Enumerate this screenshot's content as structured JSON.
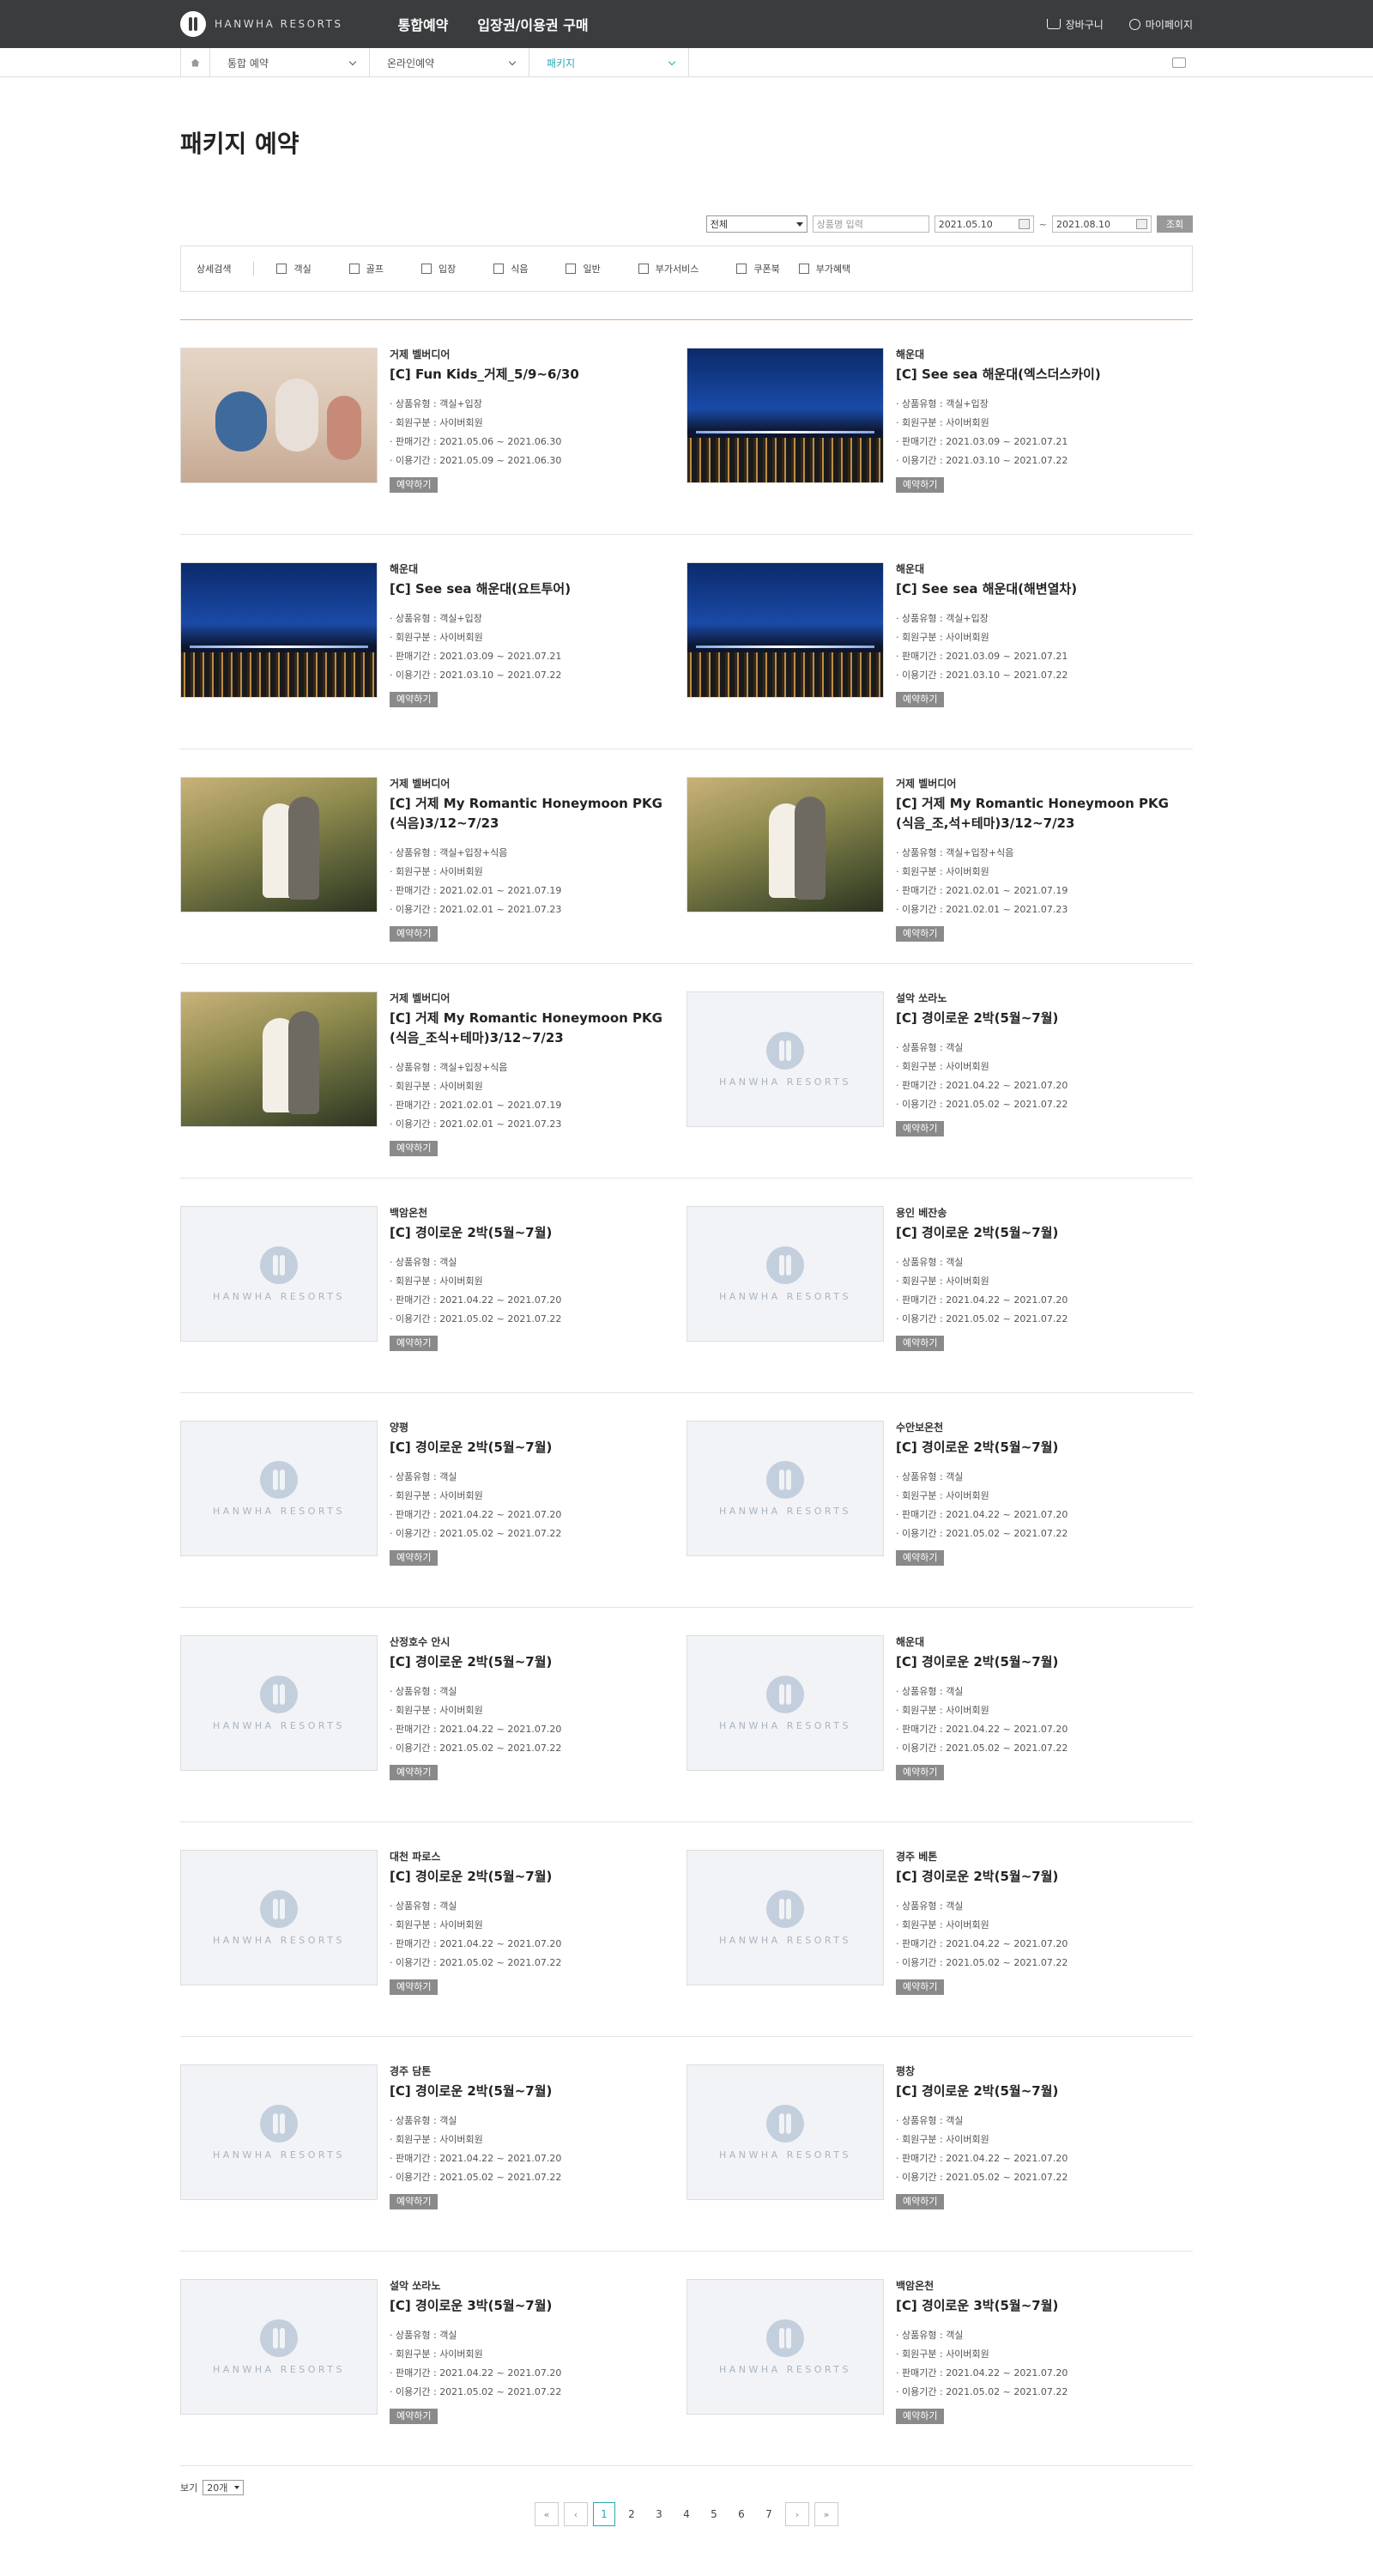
{
  "header": {
    "logo_text": "HANWHA RESORTS",
    "nav": [
      "통합예약",
      "입장권/이용권 구매"
    ],
    "cart": "장바구니",
    "mypage": "마이페이지"
  },
  "location": {
    "items": [
      {
        "label": "통합 예약",
        "active": false
      },
      {
        "label": "온라인예약",
        "active": false
      },
      {
        "label": "패키지",
        "active": true
      }
    ]
  },
  "page_title": "패키지 예약",
  "search": {
    "category_selected": "전체",
    "keyword_placeholder": "상품명 입력",
    "date_from": "2021.05.10",
    "date_to": "2021.08.10",
    "range_sep": "~",
    "search_button": "조회"
  },
  "filter": {
    "label": "상세검색",
    "options": [
      "객실",
      "골프",
      "입장",
      "식음",
      "일반",
      "부가서비스",
      "쿠폰북",
      "부가혜택"
    ]
  },
  "meta_labels": {
    "type": "상품유형",
    "member": "회원구분",
    "sale": "판매기간",
    "use": "이용기간"
  },
  "book_label": "예약하기",
  "products": [
    {
      "region": "거제 벨버디어",
      "name": "[C] Fun Kids_거제_5/9~6/30",
      "type": "객실+입장",
      "member": "사이버회원",
      "sale": "2021.05.06 ~ 2021.06.30",
      "use": "2021.05.09 ~ 2021.06.30",
      "thumb": "kids"
    },
    {
      "region": "해운대",
      "name": "[C] See sea 해운대(엑스더스카이)",
      "type": "객실+입장",
      "member": "사이버회원",
      "sale": "2021.03.09 ~ 2021.07.21",
      "use": "2021.03.10 ~ 2021.07.22",
      "thumb": "night"
    },
    {
      "region": "해운대",
      "name": "[C] See sea 해운대(요트투어)",
      "type": "객실+입장",
      "member": "사이버회원",
      "sale": "2021.03.09 ~ 2021.07.21",
      "use": "2021.03.10 ~ 2021.07.22",
      "thumb": "night"
    },
    {
      "region": "해운대",
      "name": "[C] See sea 해운대(해변열차)",
      "type": "객실+입장",
      "member": "사이버회원",
      "sale": "2021.03.09 ~ 2021.07.21",
      "use": "2021.03.10 ~ 2021.07.22",
      "thumb": "night"
    },
    {
      "region": "거제 벨버디어",
      "name": "[C] 거제 My Romantic Honeymoon PKG (식음)3/12~7/23",
      "type": "객실+입장+식음",
      "member": "사이버회원",
      "sale": "2021.02.01 ~ 2021.07.19",
      "use": "2021.02.01 ~ 2021.07.23",
      "thumb": "wedding"
    },
    {
      "region": "거제 벨버디어",
      "name": "[C] 거제 My Romantic Honeymoon PKG (식음_조,석+테마)3/12~7/23",
      "type": "객실+입장+식음",
      "member": "사이버회원",
      "sale": "2021.02.01 ~ 2021.07.19",
      "use": "2021.02.01 ~ 2021.07.23",
      "thumb": "wedding"
    },
    {
      "region": "거제 벨버디어",
      "name": "[C] 거제 My Romantic Honeymoon PKG (식음_조식+테마)3/12~7/23",
      "type": "객실+입장+식음",
      "member": "사이버회원",
      "sale": "2021.02.01 ~ 2021.07.19",
      "use": "2021.02.01 ~ 2021.07.23",
      "thumb": "wedding"
    },
    {
      "region": "설악 쏘라노",
      "name": "[C] 경이로운 2박(5월~7월)",
      "type": "객실",
      "member": "사이버회원",
      "sale": "2021.04.22 ~ 2021.07.20",
      "use": "2021.05.02 ~ 2021.07.22",
      "thumb": "placeholder"
    },
    {
      "region": "백암온천",
      "name": "[C] 경이로운 2박(5월~7월)",
      "type": "객실",
      "member": "사이버회원",
      "sale": "2021.04.22 ~ 2021.07.20",
      "use": "2021.05.02 ~ 2021.07.22",
      "thumb": "placeholder"
    },
    {
      "region": "용인 베잔송",
      "name": "[C] 경이로운 2박(5월~7월)",
      "type": "객실",
      "member": "사이버회원",
      "sale": "2021.04.22 ~ 2021.07.20",
      "use": "2021.05.02 ~ 2021.07.22",
      "thumb": "placeholder"
    },
    {
      "region": "양평",
      "name": "[C] 경이로운 2박(5월~7월)",
      "type": "객실",
      "member": "사이버회원",
      "sale": "2021.04.22 ~ 2021.07.20",
      "use": "2021.05.02 ~ 2021.07.22",
      "thumb": "placeholder"
    },
    {
      "region": "수안보온천",
      "name": "[C] 경이로운 2박(5월~7월)",
      "type": "객실",
      "member": "사이버회원",
      "sale": "2021.04.22 ~ 2021.07.20",
      "use": "2021.05.02 ~ 2021.07.22",
      "thumb": "placeholder"
    },
    {
      "region": "산정호수 안시",
      "name": "[C] 경이로운 2박(5월~7월)",
      "type": "객실",
      "member": "사이버회원",
      "sale": "2021.04.22 ~ 2021.07.20",
      "use": "2021.05.02 ~ 2021.07.22",
      "thumb": "placeholder"
    },
    {
      "region": "해운대",
      "name": "[C] 경이로운 2박(5월~7월)",
      "type": "객실",
      "member": "사이버회원",
      "sale": "2021.04.22 ~ 2021.07.20",
      "use": "2021.05.02 ~ 2021.07.22",
      "thumb": "placeholder"
    },
    {
      "region": "대천 파로스",
      "name": "[C] 경이로운 2박(5월~7월)",
      "type": "객실",
      "member": "사이버회원",
      "sale": "2021.04.22 ~ 2021.07.20",
      "use": "2021.05.02 ~ 2021.07.22",
      "thumb": "placeholder"
    },
    {
      "region": "경주 베톤",
      "name": "[C] 경이로운 2박(5월~7월)",
      "type": "객실",
      "member": "사이버회원",
      "sale": "2021.04.22 ~ 2021.07.20",
      "use": "2021.05.02 ~ 2021.07.22",
      "thumb": "placeholder"
    },
    {
      "region": "경주 담톤",
      "name": "[C] 경이로운 2박(5월~7월)",
      "type": "객실",
      "member": "사이버회원",
      "sale": "2021.04.22 ~ 2021.07.20",
      "use": "2021.05.02 ~ 2021.07.22",
      "thumb": "placeholder"
    },
    {
      "region": "평창",
      "name": "[C] 경이로운 2박(5월~7월)",
      "type": "객실",
      "member": "사이버회원",
      "sale": "2021.04.22 ~ 2021.07.20",
      "use": "2021.05.02 ~ 2021.07.22",
      "thumb": "placeholder"
    },
    {
      "region": "설악 쏘라노",
      "name": "[C] 경이로운 3박(5월~7월)",
      "type": "객실",
      "member": "사이버회원",
      "sale": "2021.04.22 ~ 2021.07.20",
      "use": "2021.05.02 ~ 2021.07.22",
      "thumb": "placeholder"
    },
    {
      "region": "백암온천",
      "name": "[C] 경이로운 3박(5월~7월)",
      "type": "객실",
      "member": "사이버회원",
      "sale": "2021.04.22 ~ 2021.07.20",
      "use": "2021.05.02 ~ 2021.07.22",
      "thumb": "placeholder"
    }
  ],
  "placeholder_text": "HANWHA RESORTS",
  "pagination": {
    "view_label": "보기",
    "page_size": "20개",
    "pages": [
      "1",
      "2",
      "3",
      "4",
      "5",
      "6",
      "7"
    ],
    "current": "1",
    "first": "«",
    "prev": "‹",
    "next": "›",
    "last": "»"
  },
  "colors": {
    "header_bg": "#3a3c3e",
    "accent": "#2ba8b5",
    "divider": "#d8a98e",
    "button_gray": "#8a8a8a"
  }
}
